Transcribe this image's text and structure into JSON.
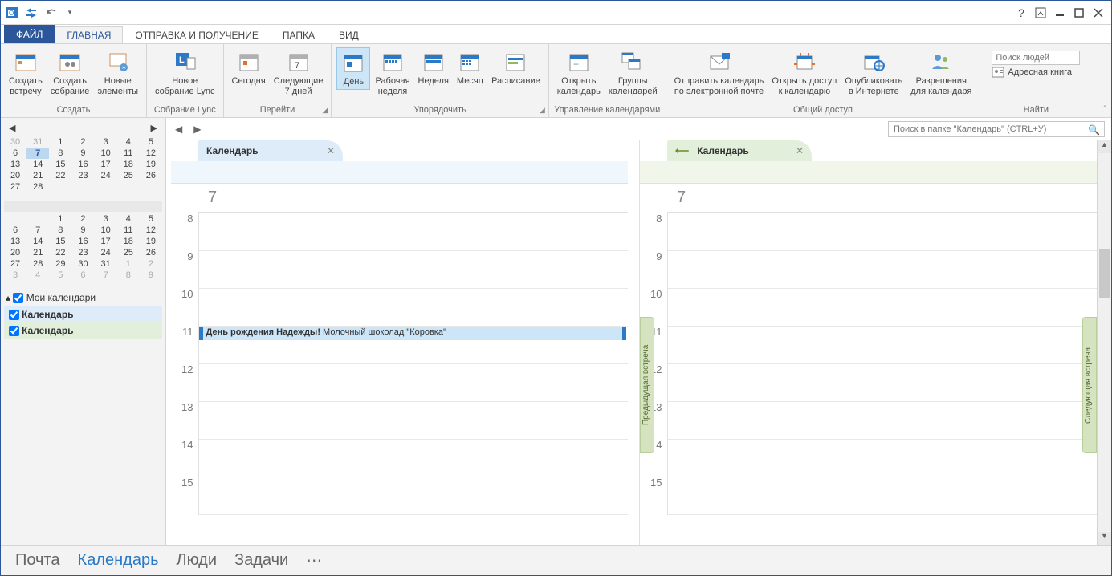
{
  "titlebar": {
    "help_tip": "?",
    "ribbon_toggle_tip": "⬚"
  },
  "tabs": {
    "file": "ФАЙЛ",
    "home": "ГЛАВНАЯ",
    "sendreceive": "ОТПРАВКА И ПОЛУЧЕНИЕ",
    "folder": "ПАПКА",
    "view": "ВИД"
  },
  "ribbon": {
    "create": {
      "label": "Создать",
      "new_meeting": "Создать\nвстречу",
      "new_appointment": "Создать\nсобрание",
      "new_items": "Новые\nэлементы"
    },
    "lync": {
      "label": "Собрание Lync",
      "btn": "Новое\nсобрание Lync"
    },
    "goto": {
      "label": "Перейти",
      "today": "Сегодня",
      "next7": "Следующие\n7 дней"
    },
    "arrange": {
      "label": "Упорядочить",
      "day": "День",
      "workweek": "Рабочая\nнеделя",
      "week": "Неделя",
      "month": "Месяц",
      "schedule": "Расписание"
    },
    "manage": {
      "label": "Управление календарями",
      "open": "Открыть\nкалендарь",
      "groups": "Группы\nкалендарей"
    },
    "share": {
      "label": "Общий доступ",
      "email": "Отправить календарь\nпо электронной почте",
      "access": "Открыть доступ\nк календарю",
      "publish": "Опубликовать\nв Интернете",
      "perm": "Разрешения\nдля календаря"
    },
    "find": {
      "label": "Найти",
      "people_ph": "Поиск людей",
      "address": "Адресная книга"
    }
  },
  "sidebar": {
    "month1": {
      "weeks": [
        [
          "30",
          "31",
          "1",
          "2",
          "3",
          "4",
          "5"
        ],
        [
          "6",
          "7",
          "8",
          "9",
          "10",
          "11",
          "12"
        ],
        [
          "13",
          "14",
          "15",
          "16",
          "17",
          "18",
          "19"
        ],
        [
          "20",
          "21",
          "22",
          "23",
          "24",
          "25",
          "26"
        ],
        [
          "27",
          "28",
          "",
          "",
          "",
          "",
          ""
        ]
      ],
      "dim_cells": [
        [
          0,
          0
        ],
        [
          0,
          1
        ]
      ],
      "today": [
        1,
        1
      ]
    },
    "month2": {
      "weeks": [
        [
          "",
          "",
          "1",
          "2",
          "3",
          "4",
          "5"
        ],
        [
          "6",
          "7",
          "8",
          "9",
          "10",
          "11",
          "12"
        ],
        [
          "13",
          "14",
          "15",
          "16",
          "17",
          "18",
          "19"
        ],
        [
          "20",
          "21",
          "22",
          "23",
          "24",
          "25",
          "26"
        ],
        [
          "27",
          "28",
          "29",
          "30",
          "31",
          "1",
          "2"
        ],
        [
          "3",
          "4",
          "5",
          "6",
          "7",
          "8",
          "9"
        ]
      ],
      "dim_cells": [
        [
          4,
          5
        ],
        [
          4,
          6
        ],
        [
          5,
          0
        ],
        [
          5,
          1
        ],
        [
          5,
          2
        ],
        [
          5,
          3
        ],
        [
          5,
          4
        ],
        [
          5,
          5
        ],
        [
          5,
          6
        ]
      ]
    },
    "my_calendars": "Мои календари",
    "cal1": "Календарь",
    "cal2": "Календарь"
  },
  "calview": {
    "search_ph": "Поиск в папке \"Календарь\" (CTRL+У)",
    "tab1": "Календарь",
    "tab2": "Календарь",
    "daynum1": "7",
    "daynum2": "7",
    "hours": [
      "8",
      "9",
      "10",
      "11",
      "12",
      "13",
      "14",
      "15"
    ],
    "event_title": "День рождения Надежды!",
    "event_body": " Молочный шоколад \"Коровка\"",
    "prev_meeting": "Предыдущая встреча",
    "next_meeting": "Следующая встреча"
  },
  "bottomnav": {
    "mail": "Почта",
    "calendar": "Календарь",
    "people": "Люди",
    "tasks": "Задачи",
    "more": "⋯"
  }
}
